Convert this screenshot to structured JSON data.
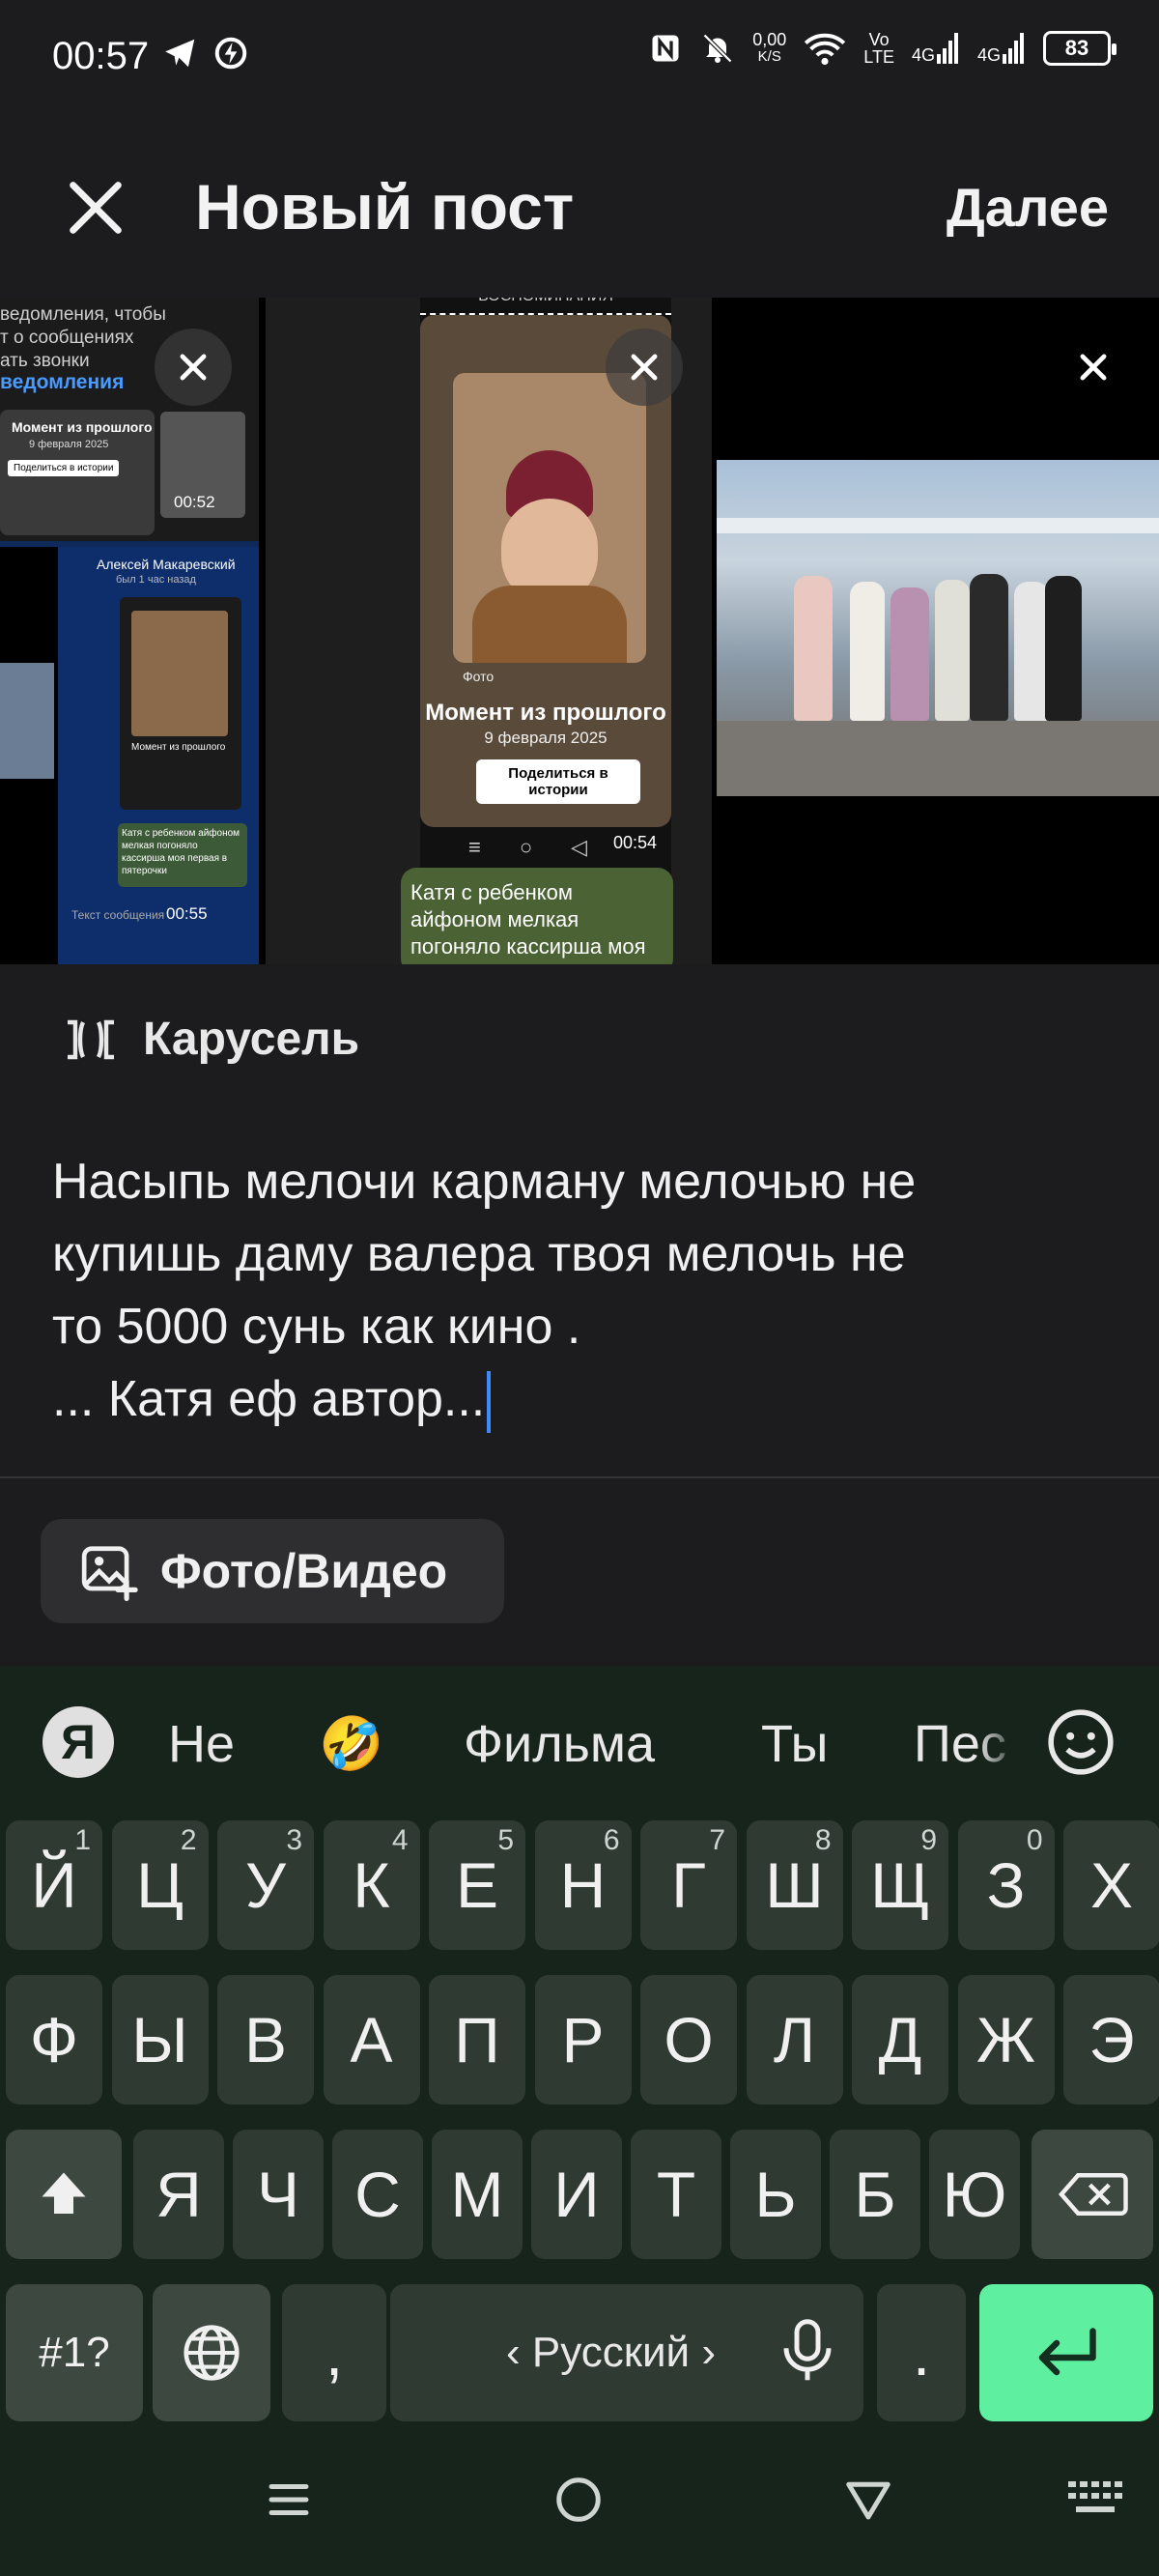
{
  "status_bar": {
    "time": "00:57",
    "net_speed_value": "0,00",
    "net_speed_unit": "K/S",
    "volte_top": "Vo",
    "volte_bottom": "LTE",
    "signal1": "4G",
    "signal2": "4G",
    "battery": "83"
  },
  "header": {
    "title": "Новый пост",
    "next_label": "Далее"
  },
  "media": {
    "item1": {
      "lines": [
        "ведомления, чтобы",
        "т о сообщениях",
        "ать звонки"
      ],
      "link": "ведомления",
      "card_title": "Момент из прошлого",
      "card_date": "9 февраля 2025",
      "card_button": "Поделиться в истории",
      "time1": "00:52",
      "chat_name": "Алексей Макаревский",
      "chat_status": "был 1 час назад",
      "mini_caption": "Катя с ребенком айфоном мелкая погоняло кассирша моя первая в пятерочки",
      "input_placeholder": "Текст сообщения",
      "time2": "00:55"
    },
    "item2": {
      "top_label": "ВОСПОМИНАНИЯ",
      "source": "Фото",
      "card_title": "Момент из прошлого",
      "card_date": "9 февраля 2025",
      "card_button": "Поделиться в истории",
      "time": "00:54",
      "message": "Катя с ребенком айфоном мелкая погоняло кассирша моя первая из"
    }
  },
  "carousel_label": "Карусель",
  "post_text": {
    "line1": "Насыпь мелочи карману мелочью не",
    "line2": "купишь даму валера твоя мелочь не",
    "line3": "то 5000 сунь как кино .",
    "line4": "... Катя еф автор..."
  },
  "media_button_label": "Фото/Видео",
  "keyboard": {
    "logo": "Я",
    "suggestions": [
      "Не",
      "🤣",
      "Фильма",
      "Ты",
      "Пес"
    ],
    "row1": [
      {
        "k": "Й",
        "n": "1"
      },
      {
        "k": "Ц",
        "n": "2"
      },
      {
        "k": "У",
        "n": "3"
      },
      {
        "k": "К",
        "n": "4"
      },
      {
        "k": "Е",
        "n": "5"
      },
      {
        "k": "Н",
        "n": "6"
      },
      {
        "k": "Г",
        "n": "7"
      },
      {
        "k": "Ш",
        "n": "8"
      },
      {
        "k": "Щ",
        "n": "9"
      },
      {
        "k": "З",
        "n": "0"
      },
      {
        "k": "Х",
        "n": ""
      }
    ],
    "row2": [
      "Ф",
      "Ы",
      "В",
      "А",
      "П",
      "Р",
      "О",
      "Л",
      "Д",
      "Ж",
      "Э"
    ],
    "row3": [
      "Я",
      "Ч",
      "С",
      "М",
      "И",
      "Т",
      "Ь",
      "Б",
      "Ю"
    ],
    "symbols_label": "#1?",
    "comma": ",",
    "space_label": "‹ Русский ›",
    "period": "."
  }
}
